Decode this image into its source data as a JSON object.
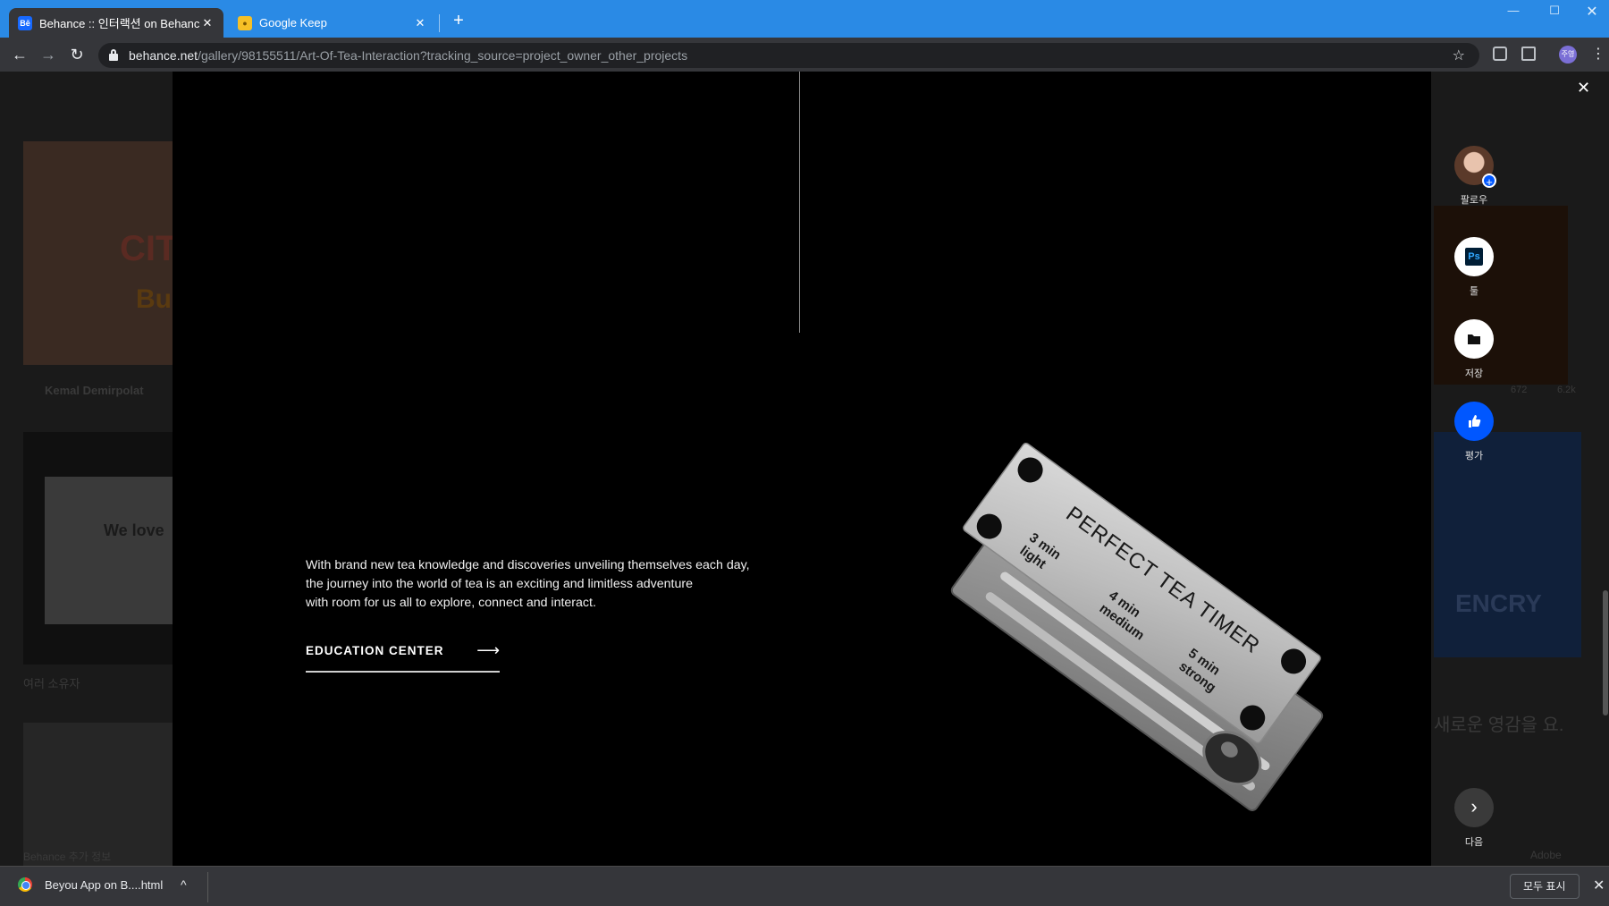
{
  "browser": {
    "tabs": [
      {
        "label": "Behance :: 인터랙션 on Behance",
        "favicon": "behance-icon",
        "active": true
      },
      {
        "label": "Google Keep",
        "favicon": "google-keep-icon",
        "active": false
      }
    ],
    "url_host": "behance.net",
    "url_path": "/gallery/98155511/Art-Of-Tea-Interaction?tracking_source=project_owner_other_projects",
    "profile_label": "주영"
  },
  "background_page": {
    "author_1": "Kemal Demirpolat",
    "card_word_1": "CIT",
    "card_word_2": "Bu",
    "card_word_3": "We love",
    "owners_label": "여러 소유자",
    "footer_label": "Behance 추가 정보",
    "right_likes": "672",
    "right_views": "6.2k",
    "right_card_word": "ENCRY",
    "promo_text": "새로운 영감을 요.",
    "adobe_label": "Adobe"
  },
  "project": {
    "description_lines": [
      "With brand new tea knowledge and discoveries unveiling themselves each day,",
      "the journey into the world of tea is an exciting and limitless adventure",
      "with room for us all to explore, connect and interact."
    ],
    "cta_label": "EDUCATION CENTER",
    "timer": {
      "title": "PERFECT TEA TIMER",
      "presets": [
        {
          "time": "3 min",
          "strength": "light"
        },
        {
          "time": "4 min",
          "strength": "medium"
        },
        {
          "time": "5 min",
          "strength": "strong"
        }
      ]
    }
  },
  "rail": {
    "follow_label": "팔로우",
    "tools_label": "툴",
    "tools_icon_text": "Ps",
    "save_label": "저장",
    "appreciate_label": "평가",
    "next_label": "다음"
  },
  "downloads": {
    "file_name": "Beyou App on B....html",
    "show_all_label": "모두 표시"
  },
  "colors": {
    "chrome_titlebar": "#2a8ae5",
    "behance_blue": "#0057ff",
    "modal_bg": "#000000"
  }
}
